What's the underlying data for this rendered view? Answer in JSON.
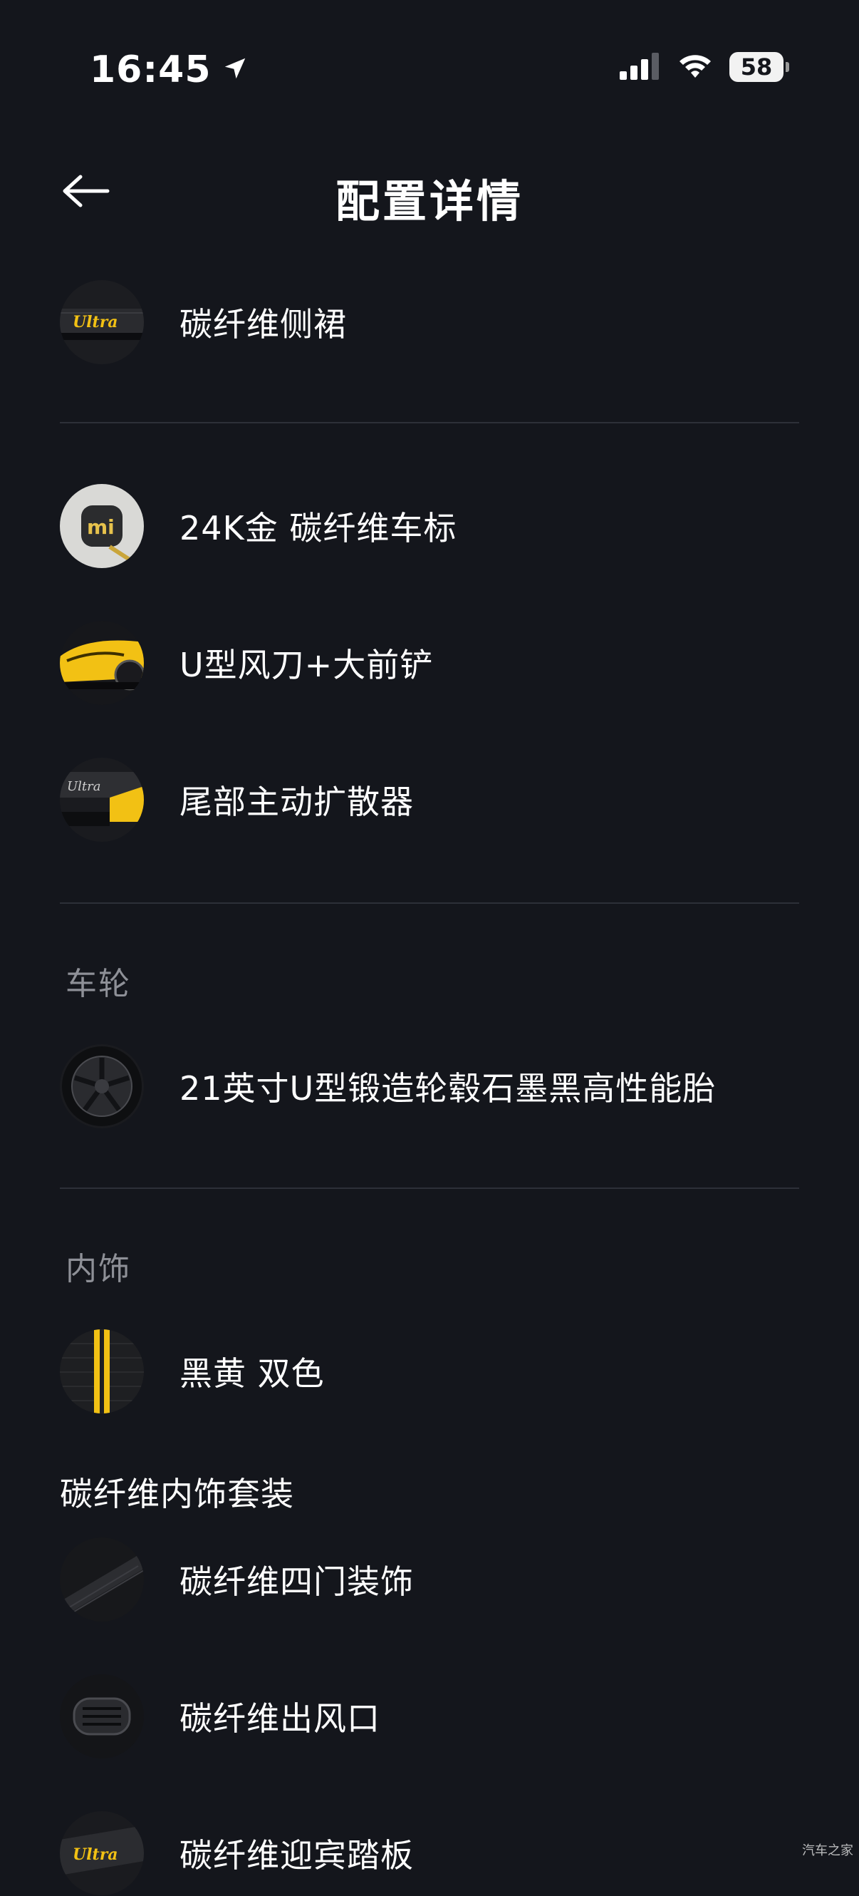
{
  "status_bar": {
    "time": "16:45",
    "battery": "58"
  },
  "header": {
    "title": "配置详情"
  },
  "items_top": [
    {
      "label": "碳纤维侧裙",
      "icon": "carbon-side-skirt"
    }
  ],
  "items_group2": [
    {
      "label": "24K金 碳纤维车标",
      "icon": "gold-logo"
    },
    {
      "label": "U型风刀+大前铲",
      "icon": "front-splitter"
    },
    {
      "label": "尾部主动扩散器",
      "icon": "rear-diffuser"
    }
  ],
  "wheels": {
    "section_title": "车轮",
    "items": [
      {
        "label": "21英寸U型锻造轮毂石墨黑高性能胎",
        "icon": "wheel"
      }
    ]
  },
  "interior": {
    "section_title": "内饰",
    "items": [
      {
        "label": "黑黄 双色",
        "icon": "black-yellow-swatch"
      }
    ],
    "carbon_pack": {
      "title": "碳纤维内饰套装",
      "items": [
        {
          "label": "碳纤维四门装饰",
          "icon": "door-trim"
        },
        {
          "label": "碳纤维出风口",
          "icon": "air-vent"
        },
        {
          "label": "碳纤维迎宾踏板",
          "icon": "door-sill"
        }
      ]
    }
  },
  "watermark": "汽车之家",
  "colors": {
    "background": "#14161c",
    "accent_yellow": "#f2c114",
    "divider": "#2d3038",
    "section_header": "#8e9097"
  }
}
